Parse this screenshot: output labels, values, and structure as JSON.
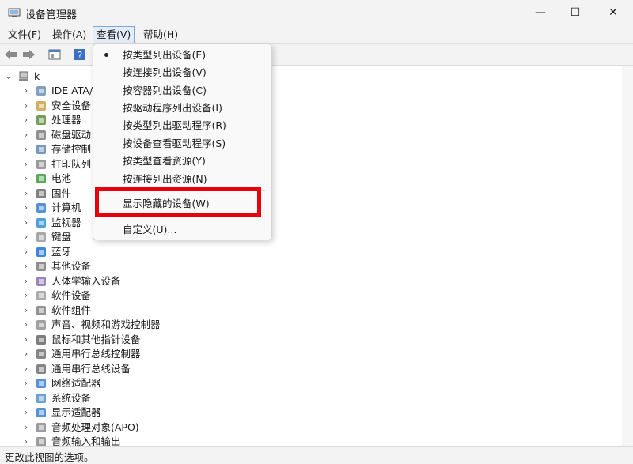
{
  "window": {
    "title": "设备管理器",
    "controls": {
      "minimize": "—",
      "maximize": "☐",
      "close": "✕"
    }
  },
  "menubar": {
    "items": [
      {
        "label": "文件(F)"
      },
      {
        "label": "操作(A)"
      },
      {
        "label": "查看(V)",
        "active": true
      },
      {
        "label": "帮助(H)"
      }
    ]
  },
  "view_menu": {
    "items": [
      {
        "label": "按类型列出设备(E)",
        "checked": true
      },
      {
        "label": "按连接列出设备(V)"
      },
      {
        "label": "按容器列出设备(C)"
      },
      {
        "label": "按驱动程序列出设备(I)"
      },
      {
        "label": "按类型列出驱动程序(R)"
      },
      {
        "label": "按设备查看驱动程序(S)"
      },
      {
        "label": "按类型查看资源(Y)"
      },
      {
        "label": "按连接列出资源(N)"
      },
      {
        "label": "显示隐藏的设备(W)",
        "highlighted": true
      },
      {
        "label": "自定义(U)..."
      }
    ]
  },
  "tree": {
    "root": "k",
    "items": [
      {
        "label": "IDE ATA/",
        "icon": "ide-controller-icon"
      },
      {
        "label": "安全设备",
        "icon": "security-device-icon"
      },
      {
        "label": "处理器",
        "icon": "processor-icon"
      },
      {
        "label": "磁盘驱动",
        "icon": "disk-drive-icon"
      },
      {
        "label": "存储控制",
        "icon": "storage-controller-icon"
      },
      {
        "label": "打印队列",
        "icon": "print-queue-icon"
      },
      {
        "label": "电池",
        "icon": "battery-icon"
      },
      {
        "label": "固件",
        "icon": "firmware-icon"
      },
      {
        "label": "计算机",
        "icon": "computer-icon"
      },
      {
        "label": "监视器",
        "icon": "monitor-icon"
      },
      {
        "label": "键盘",
        "icon": "keyboard-icon"
      },
      {
        "label": "蓝牙",
        "icon": "bluetooth-icon"
      },
      {
        "label": "其他设备",
        "icon": "other-devices-icon"
      },
      {
        "label": "人体学输入设备",
        "icon": "hid-icon"
      },
      {
        "label": "软件设备",
        "icon": "software-device-icon"
      },
      {
        "label": "软件组件",
        "icon": "software-component-icon"
      },
      {
        "label": "声音、视频和游戏控制器",
        "icon": "audio-icon"
      },
      {
        "label": "鼠标和其他指针设备",
        "icon": "mouse-icon"
      },
      {
        "label": "通用串行总线控制器",
        "icon": "usb-controller-icon"
      },
      {
        "label": "通用串行总线设备",
        "icon": "usb-device-icon"
      },
      {
        "label": "网络适配器",
        "icon": "network-adapter-icon"
      },
      {
        "label": "系统设备",
        "icon": "system-device-icon"
      },
      {
        "label": "显示适配器",
        "icon": "display-adapter-icon"
      },
      {
        "label": "音频处理对象(APO)",
        "icon": "audio-processing-icon"
      },
      {
        "label": "音频输入和输出",
        "icon": "audio-io-icon"
      }
    ]
  },
  "statusbar": {
    "text": "更改此视图的选项。"
  },
  "colors": {
    "highlight_box": "#e8000b",
    "menu_active_border": "#7aa7e0"
  }
}
